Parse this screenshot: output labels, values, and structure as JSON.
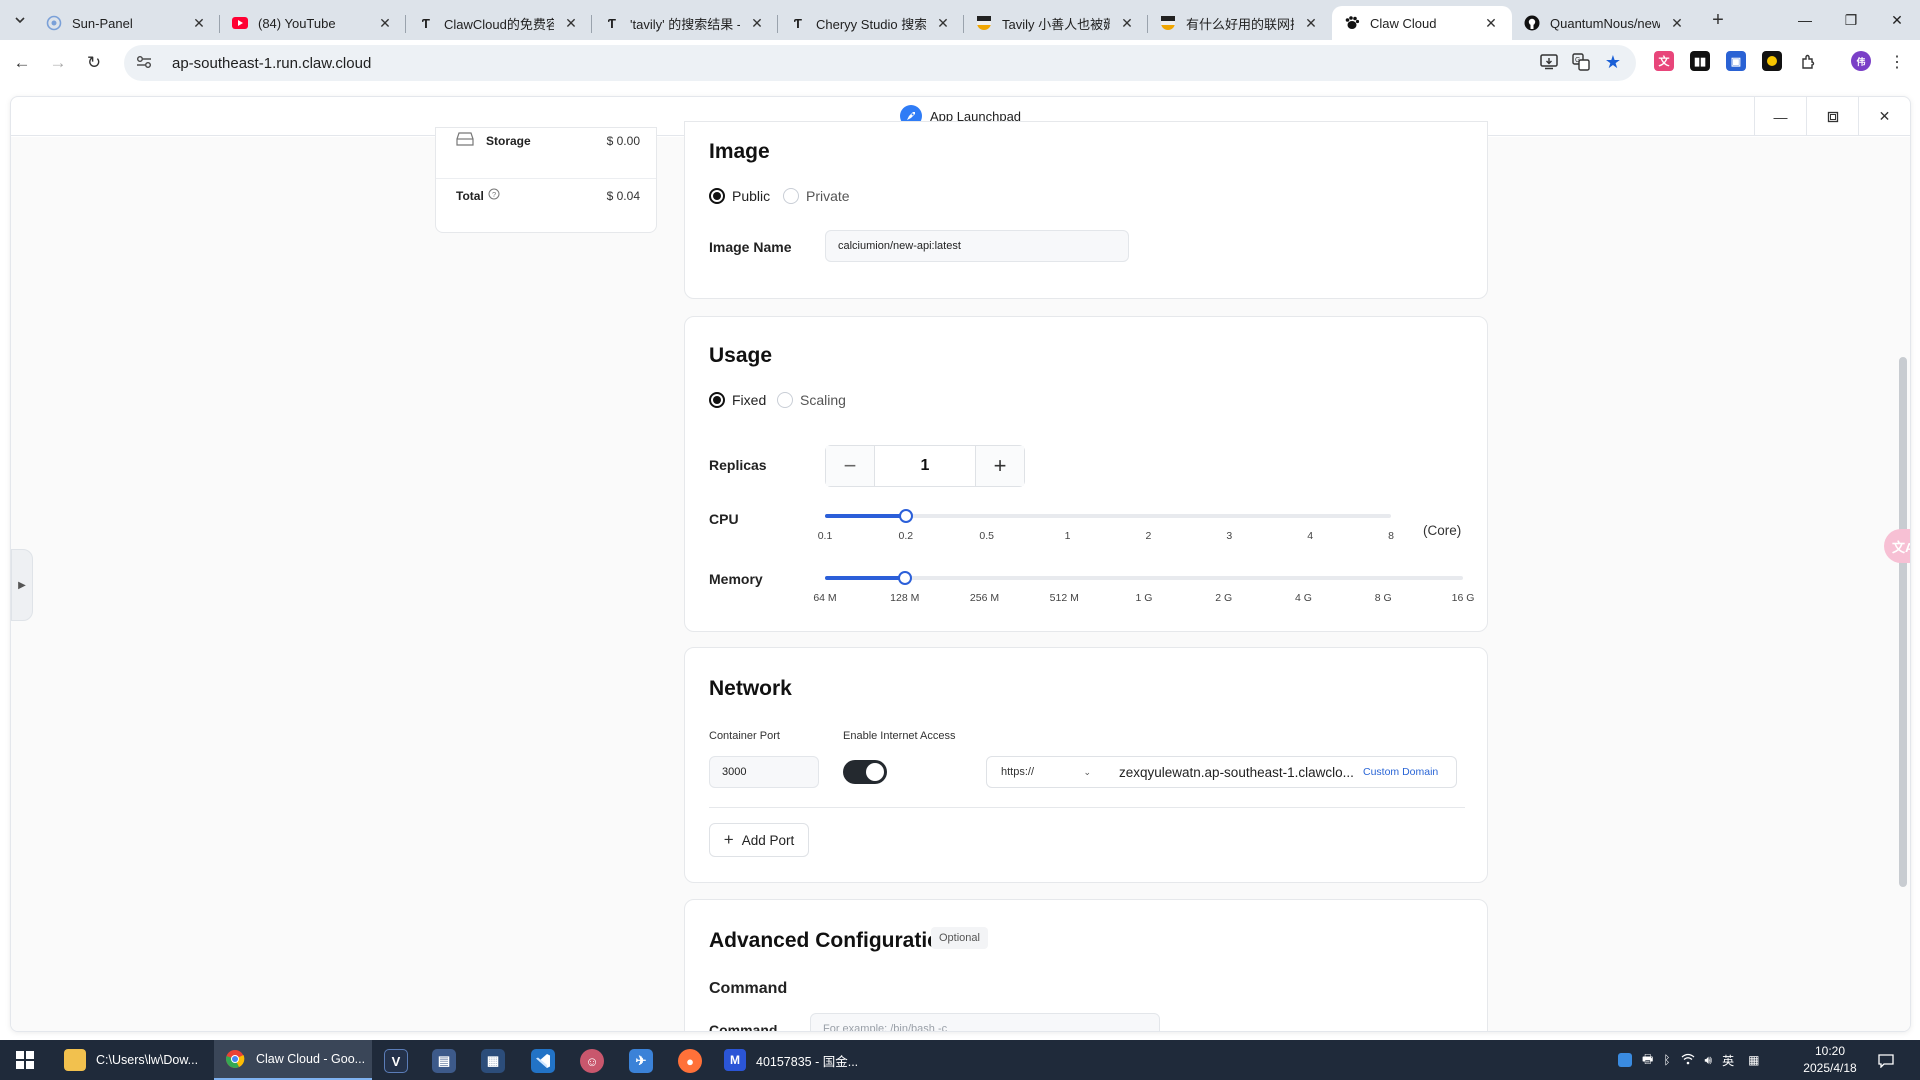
{
  "browser": {
    "tabs": [
      {
        "title": "Sun-Panel",
        "icon": "sun-panel-icon",
        "color": "#7aa0d8"
      },
      {
        "title": "(84) YouTube",
        "icon": "youtube-icon",
        "color": "#ff0033"
      },
      {
        "title": "ClawCloud的免费容",
        "icon": "tavily-icon",
        "color": "#333333"
      },
      {
        "title": "'tavily' 的搜索结果 -",
        "icon": "tavily-icon",
        "color": "#333333"
      },
      {
        "title": "Cheryy Studio 搜索",
        "icon": "tavily-icon",
        "color": "#333333"
      },
      {
        "title": "Tavily 小善人也被薅",
        "icon": "linuxdo-icon",
        "color": "#f0a500"
      },
      {
        "title": "有什么好用的联网搜",
        "icon": "linuxdo-icon",
        "color": "#f0a500"
      },
      {
        "title": "Claw Cloud",
        "icon": "claw-icon",
        "color": "#111111"
      },
      {
        "title": "QuantumNous/new",
        "icon": "github-icon",
        "color": "#111111"
      }
    ],
    "active_tab_index": 7,
    "url": "ap-southeast-1.run.claw.cloud"
  },
  "app": {
    "title": "App Launchpad"
  },
  "summary": {
    "storage_label": "Storage",
    "storage_value": "$ 0.00",
    "total_label": "Total",
    "total_value": "$ 0.04"
  },
  "image_section": {
    "title": "Image",
    "options": [
      "Public",
      "Private"
    ],
    "selected": "Public",
    "name_label": "Image Name",
    "name_value": "calciumion/new-api:latest"
  },
  "usage_section": {
    "title": "Usage",
    "options": [
      "Fixed",
      "Scaling"
    ],
    "selected": "Fixed",
    "replicas_label": "Replicas",
    "replicas_value": "1",
    "cpu_label": "CPU",
    "cpu_unit": "(Core)",
    "cpu_ticks": [
      "0.1",
      "0.2",
      "0.5",
      "1",
      "2",
      "3",
      "4",
      "8"
    ],
    "cpu_selected": "0.2",
    "memory_label": "Memory",
    "memory_ticks": [
      "64 M",
      "128 M",
      "256 M",
      "512 M",
      "1 G",
      "2 G",
      "4 G",
      "8 G",
      "16 G"
    ],
    "memory_selected": "128 M"
  },
  "network_section": {
    "title": "Network",
    "port_label": "Container Port",
    "port_value": "3000",
    "internet_label": "Enable Internet Access",
    "internet_enabled": true,
    "protocol": "https://",
    "domain": "zexqyulewatn.ap-southeast-1.clawclo...",
    "custom_domain_link": "Custom Domain",
    "add_port_label": "Add Port"
  },
  "advanced_section": {
    "title": "Advanced Configuration",
    "badge": "Optional",
    "command_heading": "Command",
    "command_label": "Command",
    "command_placeholder": "For example: /bin/bash -c"
  },
  "taskbar": {
    "items": [
      {
        "label": "C:\\Users\\lw\\Dow...",
        "icon": "folder-icon",
        "color": "#f2c14e"
      },
      {
        "label": "Claw Cloud - Goo...",
        "icon": "chrome-icon",
        "color": "#e94335"
      },
      {
        "label": "40157835 - 国金...",
        "icon": "trading-app-icon",
        "color": "#2b55d6"
      }
    ],
    "time": "10:20",
    "date": "2025/4/18",
    "ime": "英"
  },
  "colors": {
    "accent": "#2b5fd9",
    "toggle_on": "#24292f",
    "link": "#2b66d6"
  }
}
